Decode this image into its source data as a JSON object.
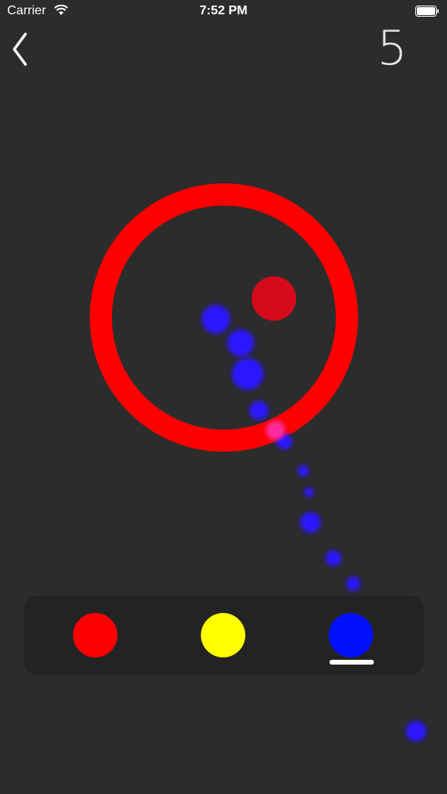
{
  "status_bar": {
    "carrier": "Carrier",
    "time": "7:52 PM"
  },
  "game": {
    "score": "5",
    "ring_color": "#ff0000",
    "target_dot_color": "#d60a1a",
    "trail_color": "#2a14ff",
    "palette": [
      {
        "name": "red",
        "color": "#ff0000",
        "selected": false
      },
      {
        "name": "yellow",
        "color": "#ffff00",
        "selected": false
      },
      {
        "name": "blue",
        "color": "#0010ff",
        "selected": true
      }
    ]
  },
  "icons": {
    "back": "chevron-left-icon",
    "wifi": "wifi-icon",
    "battery": "battery-icon"
  }
}
